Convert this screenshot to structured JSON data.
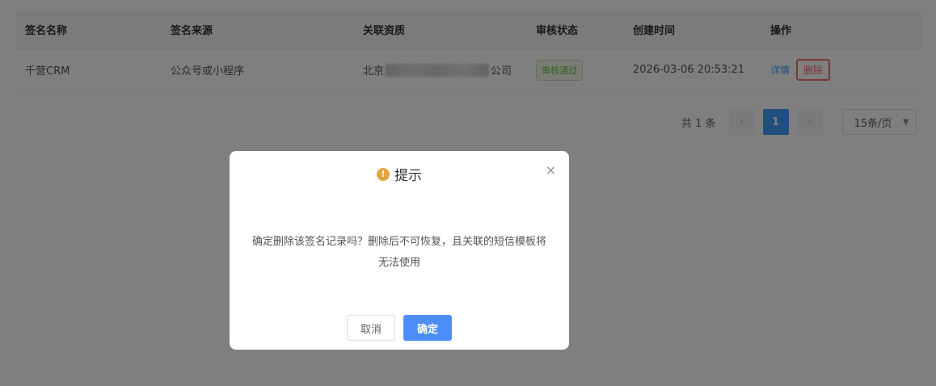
{
  "table": {
    "headers": [
      "签名名称",
      "签名来源",
      "关联资质",
      "审核状态",
      "创建时间",
      "操作"
    ],
    "rows": [
      {
        "name": "千营CRM",
        "source": "公众号或小程序",
        "qual_prefix": "北京",
        "qual_suffix": "公司",
        "status": "审核通过",
        "created": "2026-03-06 20:53:21",
        "detail": "详情",
        "delete": "删除"
      }
    ]
  },
  "pagination": {
    "total": "共 1 条",
    "prev": "‹",
    "page": "1",
    "next": "›",
    "page_size": "15条/页"
  },
  "dialog": {
    "title": "提示",
    "warn_glyph": "!",
    "close_glyph": "×",
    "message": "确定删除该签名记录吗？删除后不可恢复，且关联的短信模板将无法使用",
    "cancel": "取消",
    "confirm": "确定"
  },
  "colors": {
    "primary": "#409eff",
    "danger": "#f56c6c",
    "success": "#67c23a",
    "warning": "#e6a23c"
  }
}
